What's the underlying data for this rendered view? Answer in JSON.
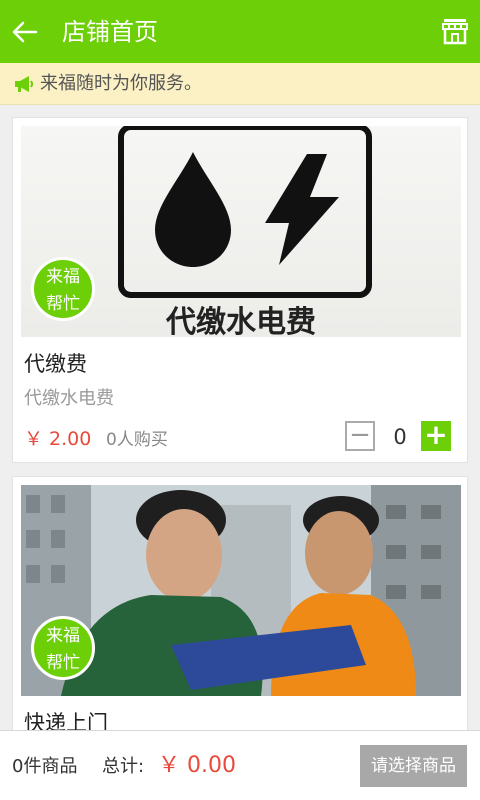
{
  "header": {
    "title": "店铺首页",
    "back_icon": "back-arrow-icon",
    "store_icon": "store-icon",
    "color": "#6ccf07"
  },
  "notice": {
    "text": "来福随时为你服务。",
    "icon": "megaphone-icon"
  },
  "products": [
    {
      "name": "代缴费",
      "desc": "代缴水电费",
      "price": "￥ 2.00",
      "sold": "0人购买",
      "qty": "0",
      "badge_line1": "来福",
      "badge_line2": "帮忙",
      "image_caption": "代缴水电费"
    },
    {
      "name": "快递上门",
      "badge_line1": "来福",
      "badge_line2": "帮忙"
    }
  ],
  "footer": {
    "count": "0件商品",
    "total_label": "总计:",
    "total": "￥ 0.00",
    "checkout": "请选择商品"
  },
  "colors": {
    "accent": "#6ccf07",
    "price": "#e84b3c",
    "notice_bg": "#fbf1c5"
  }
}
